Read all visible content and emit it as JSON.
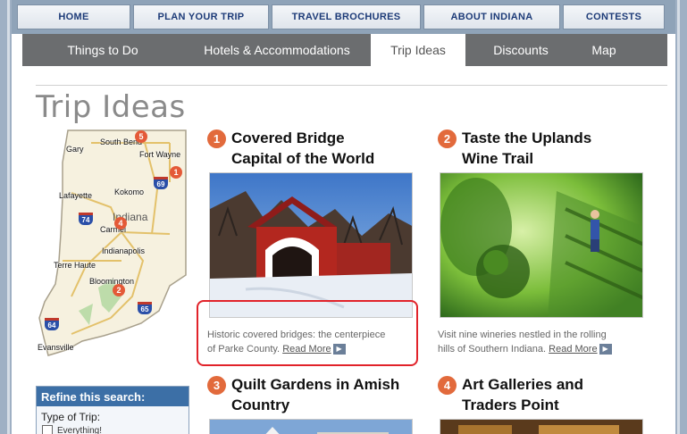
{
  "top_nav": [
    "HOME",
    "PLAN YOUR TRIP",
    "TRAVEL BROCHURES",
    "ABOUT INDIANA",
    "CONTESTS"
  ],
  "sub_nav": {
    "items": [
      "Things to Do",
      "Hotels & Accommodations",
      "Trip Ideas",
      "Discounts",
      "Map"
    ],
    "active": "Trip Ideas"
  },
  "page": {
    "title": "Trip Ideas"
  },
  "map": {
    "state": "Indiana",
    "cities": [
      "South Bend",
      "Gary",
      "Fort Wayne",
      "Lafayette",
      "Kokomo",
      "Carmel",
      "Indianapolis",
      "Terre Haute",
      "Bloomington",
      "Evansville"
    ],
    "pins": [
      "5",
      "1",
      "4",
      "2"
    ],
    "highways": [
      "69",
      "74",
      "65",
      "64"
    ]
  },
  "refine": {
    "heading": "Refine this search:",
    "type_label": "Type of Trip:",
    "first_option": "Everything!"
  },
  "articles": [
    {
      "number": "1",
      "title": "Covered Bridge Capital of the World",
      "title_lines": [
        "Covered Bridge",
        "Capital of the World"
      ],
      "desc_lines": [
        "Historic covered bridges: the centerpiece",
        "of Parke County."
      ],
      "read_more": "Read More"
    },
    {
      "number": "2",
      "title": "Taste the Uplands Wine Trail",
      "title_lines": [
        "Taste the Uplands",
        "Wine Trail"
      ],
      "desc_lines": [
        "Visit nine wineries nestled in the rolling",
        "hills of Southern Indiana."
      ],
      "read_more": "Read More"
    },
    {
      "number": "3",
      "title": "Quilt Gardens in Amish Country",
      "title_lines": [
        "Quilt Gardens in Amish",
        "Country"
      ]
    },
    {
      "number": "4",
      "title": "Art Galleries and Traders Point",
      "title_lines": [
        "Art Galleries and",
        "Traders Point"
      ]
    }
  ],
  "colors": {
    "accent_number": "#e26a3c",
    "subnav_bg": "#6b6d6f",
    "refine_header": "#3c6fa6",
    "highlight": "#e1232a"
  }
}
